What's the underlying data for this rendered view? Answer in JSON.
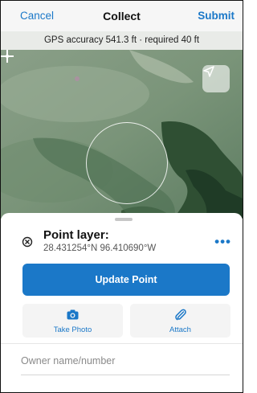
{
  "navbar": {
    "cancel_label": "Cancel",
    "title": "Collect",
    "submit_label": "Submit"
  },
  "gps_banner": {
    "text": "GPS accuracy 541.3 ft · required 40 ft"
  },
  "map": {
    "locate_icon": "navigation-arrow-icon",
    "crosshair_icon": "crosshair-icon"
  },
  "sheet": {
    "layer_title": "Point layer:",
    "coordinates": "28.431254°N  96.410690°W",
    "more_label": "•••",
    "update_label": "Update Point",
    "take_photo_label": "Take Photo",
    "attach_label": "Attach",
    "owner_placeholder": "Owner name/number",
    "owner_value": ""
  },
  "colors": {
    "accent": "#1b78c8",
    "nav_background": "#f6f6f6",
    "banner_background": "#e9ebe8"
  }
}
